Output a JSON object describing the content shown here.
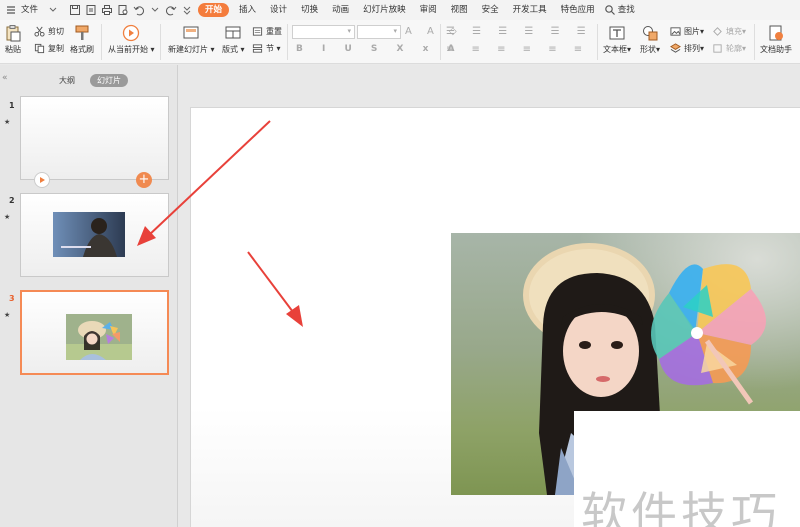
{
  "menu": {
    "file_label": "文件",
    "tabs": [
      "开始",
      "插入",
      "设计",
      "切换",
      "动画",
      "幻灯片放映",
      "审阅",
      "视图",
      "安全",
      "开发工具",
      "特色应用"
    ],
    "search_label": "查找"
  },
  "ribbon": {
    "paste": "粘贴",
    "cut": "剪切",
    "copy": "复制",
    "format_painter": "格式刷",
    "play_from_current": "从当前开始",
    "new_slide": "新建幻灯片",
    "layout": "版式",
    "reset": "重置",
    "section": "节",
    "textbox": "文本框",
    "shape": "形状",
    "picture": "图片",
    "arrange": "排列",
    "fill": "填充",
    "outline": "轮廓",
    "doc_assistant": "文档助手"
  },
  "left_panel": {
    "tab_outline": "大纲",
    "tab_slides": "幻灯片",
    "slides": [
      {
        "number": "1",
        "star": "★"
      },
      {
        "number": "2",
        "star": "★"
      },
      {
        "number": "3",
        "star": "★"
      }
    ]
  },
  "watermark": "软件技巧",
  "colors": {
    "accent": "#f47c3c",
    "arrow": "#e8413a",
    "selected_border": "#f58a55"
  }
}
